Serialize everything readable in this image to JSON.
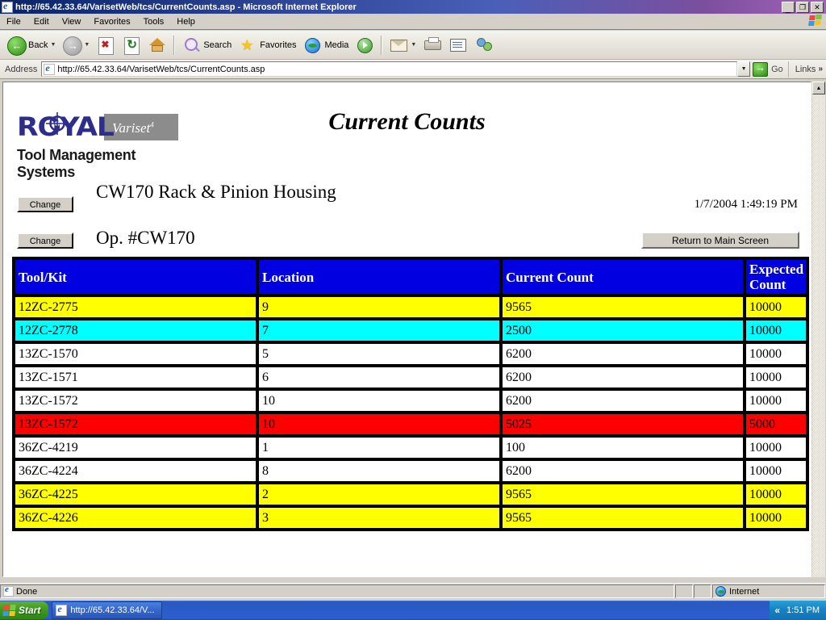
{
  "window": {
    "title": "http://65.42.33.64/VarisetWeb/tcs/CurrentCounts.asp - Microsoft Internet Explorer",
    "minimize_glyph": "_",
    "restore_glyph": "❐",
    "close_glyph": "✕"
  },
  "menu": {
    "items": [
      "File",
      "Edit",
      "View",
      "Favorites",
      "Tools",
      "Help"
    ]
  },
  "toolbar": {
    "back_label": "Back",
    "back_arrow": "←",
    "forward_arrow": "→",
    "dropdown_caret": "▼",
    "search_label": "Search",
    "favorites_label": "Favorites",
    "media_label": "Media",
    "star_glyph": "★"
  },
  "address": {
    "label": "Address",
    "value": "http://65.42.33.64/VarisetWeb/tcs/CurrentCounts.asp",
    "dropdown_caret": "▼",
    "go_label": "Go",
    "links_label": "Links",
    "links_chevron": "»"
  },
  "page": {
    "title": "Current Counts",
    "logo": {
      "brand": "ROYAL",
      "product": "Variset",
      "product_sup": "4",
      "tagline": "Tool Management Systems"
    },
    "change_button_1": "Change",
    "change_button_2": "Change",
    "job_name": "CW170 Rack & Pinion Housing",
    "op_number": "Op. #CW170",
    "timestamp": "1/7/2004 1:49:19 PM",
    "return_button": "Return to Main Screen",
    "scroll_up_glyph": "▲"
  },
  "table": {
    "headers": [
      "Tool/Kit",
      "Location",
      "Current Count",
      "Expected Count"
    ],
    "rows": [
      {
        "tool": "12ZC-2775",
        "location": "9",
        "current": "9565",
        "expected": "10000",
        "status": "yellow"
      },
      {
        "tool": "12ZC-2778",
        "location": "7",
        "current": "2500",
        "expected": "10000",
        "status": "cyan"
      },
      {
        "tool": "13ZC-1570",
        "location": "5",
        "current": "6200",
        "expected": "10000",
        "status": "white"
      },
      {
        "tool": "13ZC-1571",
        "location": "6",
        "current": "6200",
        "expected": "10000",
        "status": "white"
      },
      {
        "tool": "13ZC-1572",
        "location": "10",
        "current": "6200",
        "expected": "10000",
        "status": "white"
      },
      {
        "tool": "13ZC-1572",
        "location": "10",
        "current": "5025",
        "expected": "5000",
        "status": "red"
      },
      {
        "tool": "36ZC-4219",
        "location": "1",
        "current": "100",
        "expected": "10000",
        "status": "white"
      },
      {
        "tool": "36ZC-4224",
        "location": "8",
        "current": "6200",
        "expected": "10000",
        "status": "white"
      },
      {
        "tool": "36ZC-4225",
        "location": "2",
        "current": "9565",
        "expected": "10000",
        "status": "yellow"
      },
      {
        "tool": "36ZC-4226",
        "location": "3",
        "current": "9565",
        "expected": "10000",
        "status": "yellow"
      }
    ],
    "colors": {
      "header_bg": "#0000e0",
      "header_fg": "#ffffff",
      "yellow": "#ffff00",
      "cyan": "#00ffff",
      "red": "#ff0000",
      "white": "#ffffff"
    }
  },
  "statusbar": {
    "message": "Done",
    "zone": "Internet"
  },
  "taskbar": {
    "start_label": "Start",
    "window_button": "http://65.42.33.64/V...",
    "tray_chevron": "«",
    "clock": "1:51 PM"
  }
}
